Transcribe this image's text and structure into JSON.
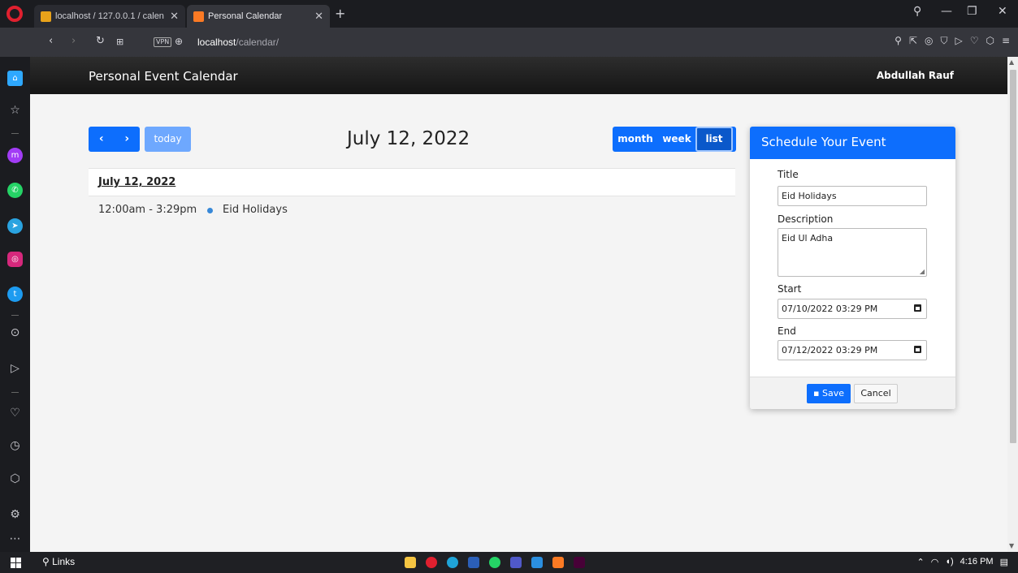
{
  "browser": {
    "tabs": [
      {
        "label": "localhost / 127.0.0.1 / calen",
        "icon": "phpmyadmin-icon"
      },
      {
        "label": "Personal Calendar",
        "icon": "xampp-icon"
      }
    ],
    "address": {
      "host": "localhost",
      "path": "/calendar/",
      "vpn_label": "VPN"
    }
  },
  "site": {
    "title": "Personal Event Calendar",
    "user": "Abdullah Rauf"
  },
  "calendar": {
    "today_label": "today",
    "current_title": "July 12, 2022",
    "views": [
      "month",
      "week",
      "list"
    ],
    "active_view": "list",
    "list": {
      "date_heading": "July 12, 2022",
      "events": [
        {
          "time": "12:00am - 3:29pm",
          "title": "Eid Holidays",
          "color": "#3788d8"
        }
      ]
    }
  },
  "form": {
    "heading": "Schedule Your Event",
    "title_label": "Title",
    "title_value": "Eid Holidays",
    "description_label": "Description",
    "description_value": "Eid Ul Adha",
    "start_label": "Start",
    "start_value": "07/10/2022 03:29 PM",
    "end_label": "End",
    "end_value": "07/12/2022 03:29 PM",
    "save_label": "Save",
    "cancel_label": "Cancel"
  },
  "taskbar": {
    "search_label": "Links",
    "time": "4:16 PM"
  },
  "colors": {
    "primary": "#0d6efd",
    "primary_light": "#6ea8fe",
    "header_dark": "#1e1e1e"
  }
}
